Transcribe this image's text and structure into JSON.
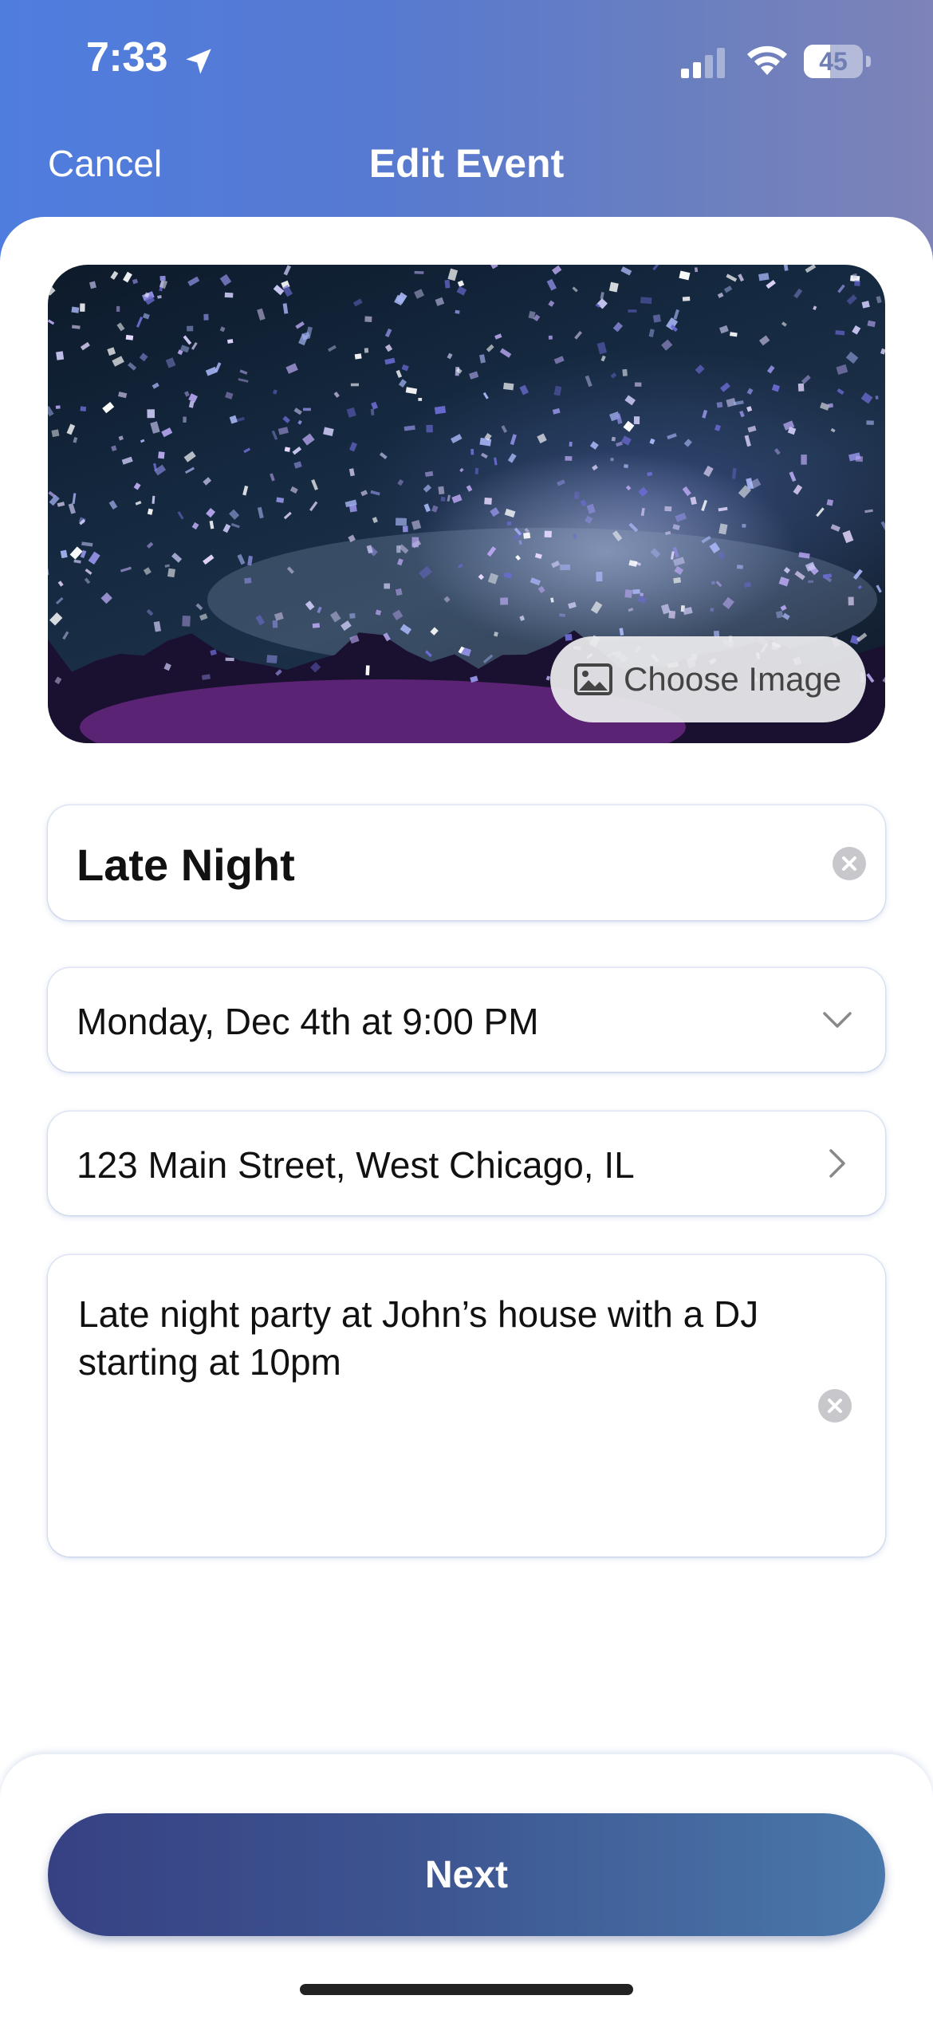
{
  "status_bar": {
    "time": "7:33",
    "battery_percent": "45",
    "battery_level": 0.45,
    "signal_bars_active": 2,
    "signal_bars_total": 4,
    "icons": [
      "location-arrow-icon",
      "cellular-signal-icon",
      "wifi-icon",
      "battery-icon"
    ]
  },
  "nav": {
    "cancel_label": "Cancel",
    "title": "Edit Event"
  },
  "cover_image": {
    "description_icon": "image-icon",
    "choose_label": "Choose Image"
  },
  "form": {
    "title_value": "Late Night",
    "date_value": "Monday, Dec 4th at 9:00 PM",
    "address_value": "123 Main Street, West Chicago, IL",
    "description_value": "Late night party at John’s house with a DJ starting at 10pm"
  },
  "footer": {
    "next_label": "Next"
  },
  "colors": {
    "header_gradient_start": "#4f7ddf",
    "header_gradient_end": "#7e83b8",
    "button_gradient_start": "#364183",
    "button_gradient_end": "#4a78aa"
  }
}
